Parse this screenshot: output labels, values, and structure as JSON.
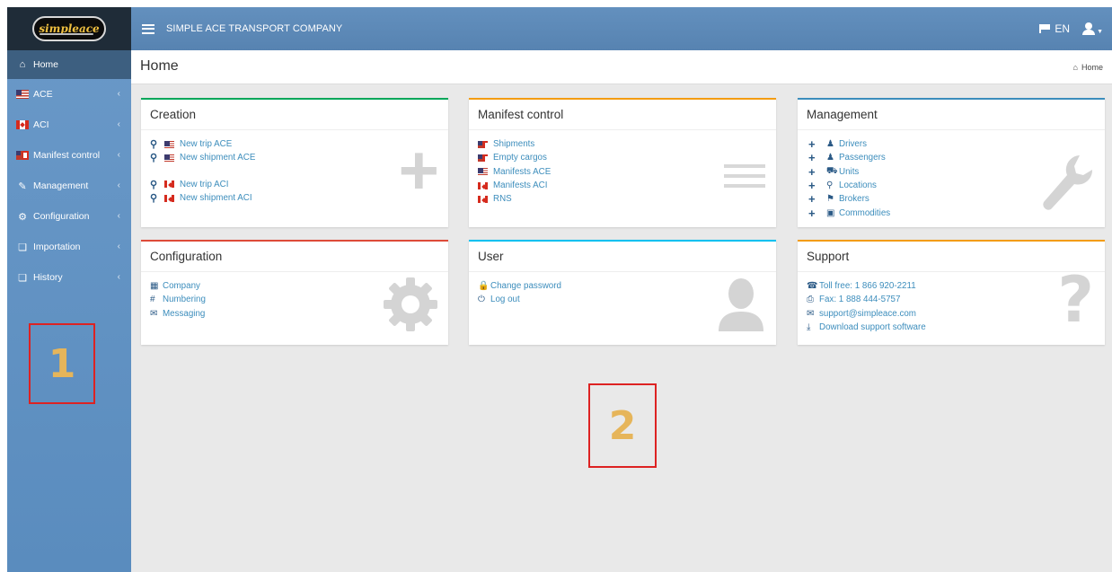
{
  "app": {
    "company_name": "SIMPLE ACE TRANSPORT COMPANY",
    "logo_text": "simpleace",
    "language": "EN"
  },
  "sidebar": {
    "items": [
      {
        "label": "Home",
        "icon": "home-icon"
      },
      {
        "label": "ACE",
        "icon": "us-flag-icon"
      },
      {
        "label": "ACI",
        "icon": "ca-flag-icon"
      },
      {
        "label": "Manifest control",
        "icon": "us-ca-flag-icon"
      },
      {
        "label": "Management",
        "icon": "edit-icon"
      },
      {
        "label": "Configuration",
        "icon": "cogs-icon"
      },
      {
        "label": "Importation",
        "icon": "files-icon"
      },
      {
        "label": "History",
        "icon": "files-icon"
      }
    ],
    "chevron": "‹"
  },
  "page": {
    "title": "Home",
    "breadcrumb": "Home"
  },
  "cards": {
    "creation": {
      "title": "Creation",
      "links": [
        "New trip ACE",
        "New shipment ACE",
        "New trip ACI",
        "New shipment ACI"
      ]
    },
    "manifest": {
      "title": "Manifest control",
      "links": [
        "Shipments",
        "Empty cargos",
        "Manifests ACE",
        "Manifests ACI",
        "RNS"
      ]
    },
    "management": {
      "title": "Management",
      "links": [
        "Drivers",
        "Passengers",
        "Units",
        "Locations",
        "Brokers",
        "Commodities"
      ]
    },
    "configuration": {
      "title": "Configuration",
      "links": [
        "Company",
        "Numbering",
        "Messaging"
      ]
    },
    "user": {
      "title": "User",
      "links": [
        "Change password",
        "Log out"
      ]
    },
    "support": {
      "title": "Support",
      "links": [
        "Toll free: 1 866 920-2211",
        "Fax: 1 888 444-5757",
        "support@simpleace.com",
        "Download support software"
      ]
    }
  },
  "annotations": {
    "marker_1": "1",
    "marker_2": "2"
  },
  "colors": {
    "sidebar": "#5d8fc0",
    "topbar": "#5b88b6",
    "active_item": "#3d5f80",
    "link": "#3c8dbc",
    "border_creation": "#00a65a",
    "border_manifest": "#f39c12",
    "border_management": "#3c8dbc",
    "border_configuration": "#dd4b39",
    "border_user": "#00c0ef",
    "border_support": "#f39c12"
  }
}
